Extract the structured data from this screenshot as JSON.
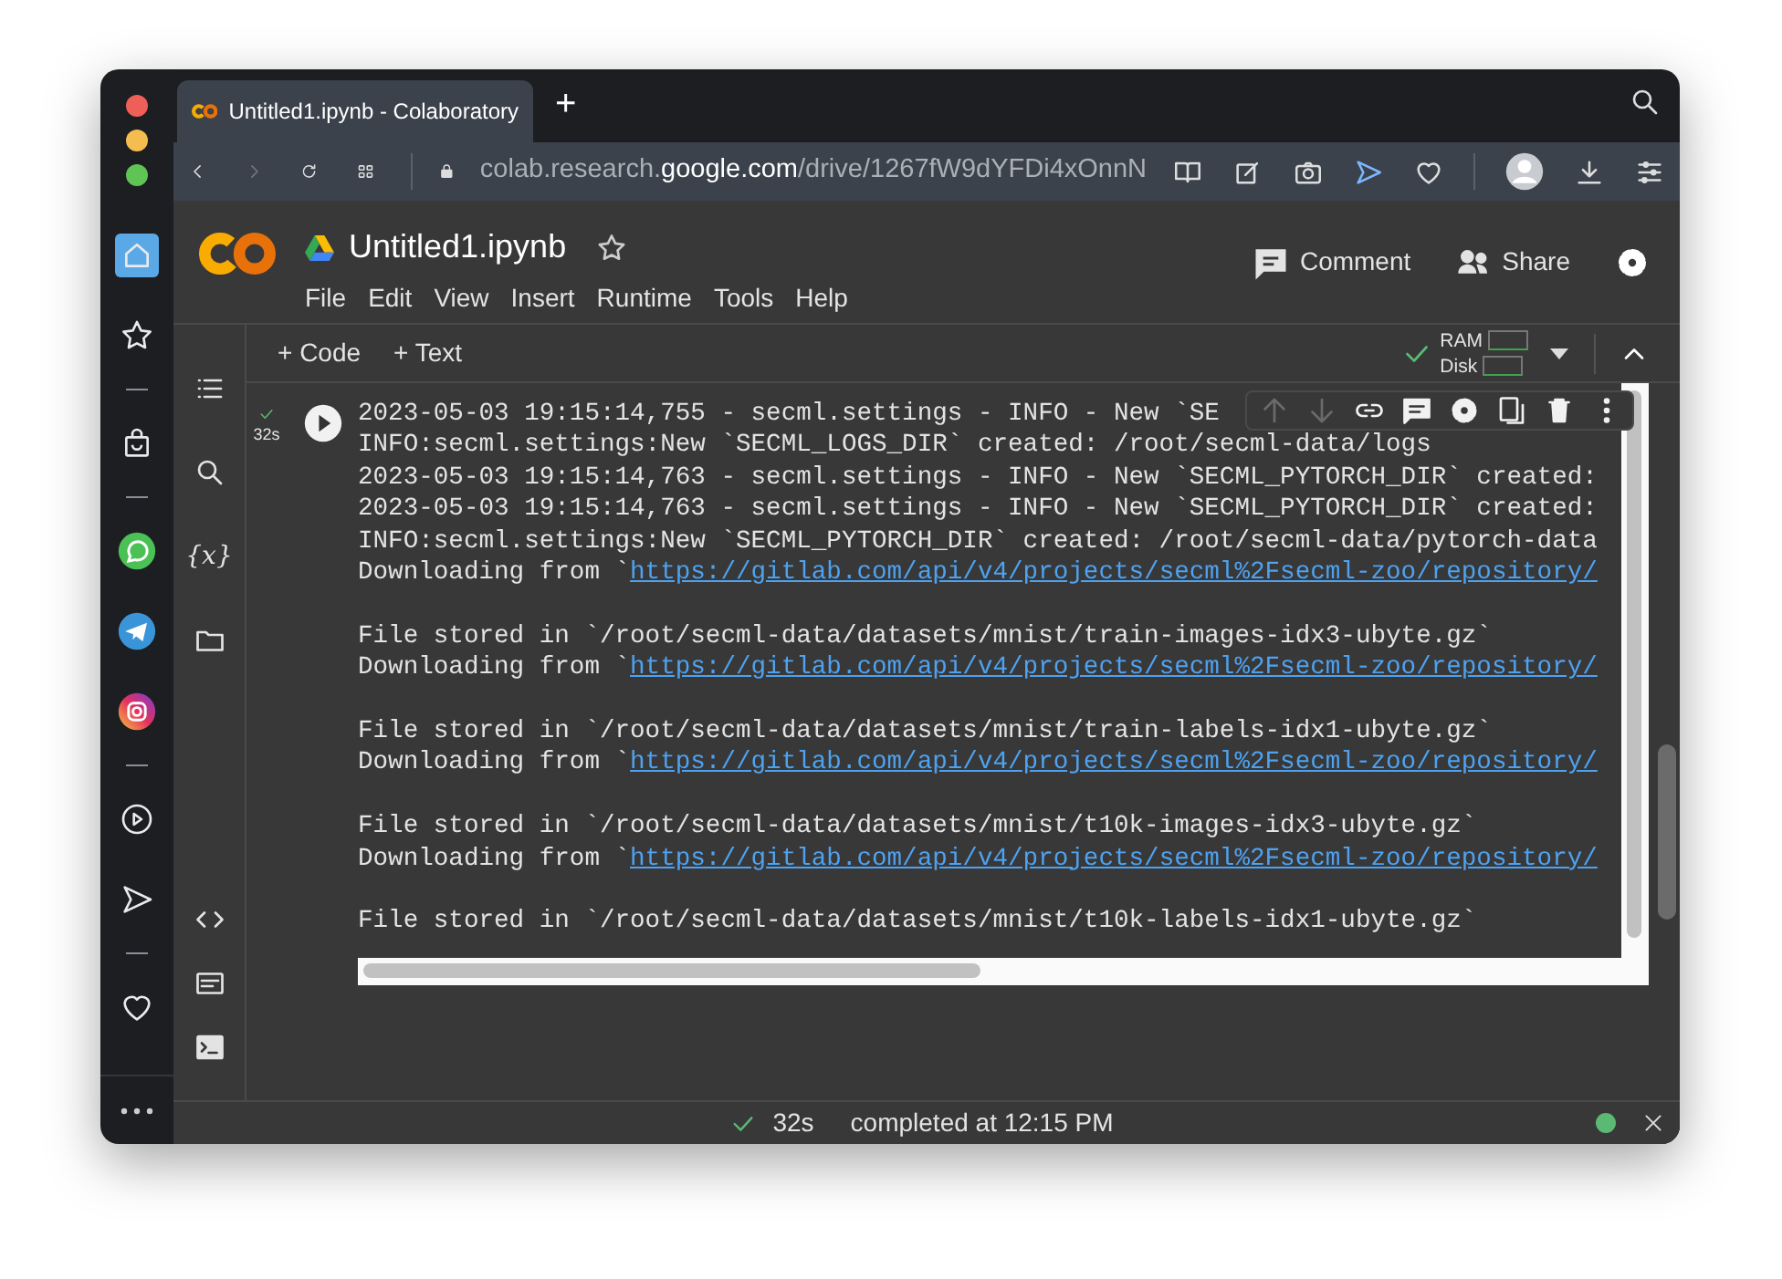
{
  "browser": {
    "sidebar": [
      {
        "kind": "home",
        "selected": true
      },
      {
        "kind": "star",
        "selected": false
      },
      {
        "kind": "divider"
      },
      {
        "kind": "bag",
        "selected": false
      },
      {
        "kind": "divider"
      },
      {
        "kind": "whatsapp",
        "selected": false
      },
      {
        "kind": "telegram",
        "selected": false
      },
      {
        "kind": "instagram",
        "selected": false
      },
      {
        "kind": "divider"
      },
      {
        "kind": "play",
        "selected": false
      },
      {
        "kind": "send",
        "selected": false
      },
      {
        "kind": "divider"
      },
      {
        "kind": "heart",
        "selected": false
      }
    ],
    "tab_title": "Untitled1.ipynb - Colaboratory",
    "new_tab": "+",
    "url_scheme_part": "colab.research.",
    "url_domain": "google.com",
    "url_path": "/drive/1267fW9dYFDi4xOnnN"
  },
  "notebook": {
    "title": "Untitled1.ipynb",
    "menu": [
      "File",
      "Edit",
      "View",
      "Insert",
      "Runtime",
      "Tools",
      "Help"
    ],
    "actions": [
      {
        "kind": "comment",
        "label": "Comment"
      },
      {
        "kind": "share",
        "label": "Share"
      }
    ]
  },
  "toolbar": {
    "add": [
      "+ Code",
      "+ Text"
    ],
    "ram": "RAM",
    "disk": "Disk"
  },
  "side_panel": [
    {
      "kind": "toc"
    },
    {
      "kind": "search"
    },
    {
      "kind": "variables",
      "glyph": "{x}"
    },
    {
      "kind": "folder"
    }
  ],
  "side_panel_bottom": [
    {
      "kind": "code"
    },
    {
      "kind": "palette"
    },
    {
      "kind": "terminal"
    }
  ],
  "cell": {
    "exec_time": "32s",
    "output": [
      {
        "lines": [
          {
            "text": "2023-05-03 19:15:14,755 - secml.settings - INFO - New `SE"
          },
          {
            "text": "INFO:secml.settings:New `SECML_LOGS_DIR` created: /root/secml-data/logs"
          },
          {
            "text": "2023-05-03 19:15:14,763 - secml.settings - INFO - New `SECML_PYTORCH_DIR` created:"
          },
          {
            "text": "2023-05-03 19:15:14,763 - secml.settings - INFO - New `SECML_PYTORCH_DIR` created:"
          },
          {
            "text": "INFO:secml.settings:New `SECML_PYTORCH_DIR` created: /root/secml-data/pytorch-data"
          },
          {
            "text": "Downloading from `",
            "link": "https://gitlab.com/api/v4/projects/secml%2Fsecml-zoo/repository/"
          }
        ]
      },
      {
        "lines": [
          {
            "text": "File stored in `/root/secml-data/datasets/mnist/train-images-idx3-ubyte.gz`"
          },
          {
            "text": "Downloading from `",
            "link": "https://gitlab.com/api/v4/projects/secml%2Fsecml-zoo/repository/"
          }
        ]
      },
      {
        "lines": [
          {
            "text": "File stored in `/root/secml-data/datasets/mnist/train-labels-idx1-ubyte.gz`"
          },
          {
            "text": "Downloading from `",
            "link": "https://gitlab.com/api/v4/projects/secml%2Fsecml-zoo/repository/"
          }
        ]
      },
      {
        "lines": [
          {
            "text": "File stored in `/root/secml-data/datasets/mnist/t10k-images-idx3-ubyte.gz`"
          },
          {
            "text": "Downloading from `",
            "link": "https://gitlab.com/api/v4/projects/secml%2Fsecml-zoo/repository/"
          }
        ]
      },
      {
        "lines": [
          {
            "text": "File stored in `/root/secml-data/datasets/mnist/t10k-labels-idx1-ubyte.gz`"
          }
        ]
      }
    ],
    "cell_tools": [
      {
        "kind": "up",
        "disabled": true
      },
      {
        "kind": "down",
        "disabled": true
      },
      {
        "kind": "link",
        "disabled": false
      },
      {
        "kind": "comment",
        "disabled": false
      },
      {
        "kind": "gear",
        "disabled": false
      },
      {
        "kind": "mirror",
        "disabled": false
      },
      {
        "kind": "trash",
        "disabled": false
      },
      {
        "kind": "more",
        "disabled": false
      }
    ]
  },
  "status_bar": {
    "time": "32s",
    "text": "completed at 12:15 PM"
  }
}
